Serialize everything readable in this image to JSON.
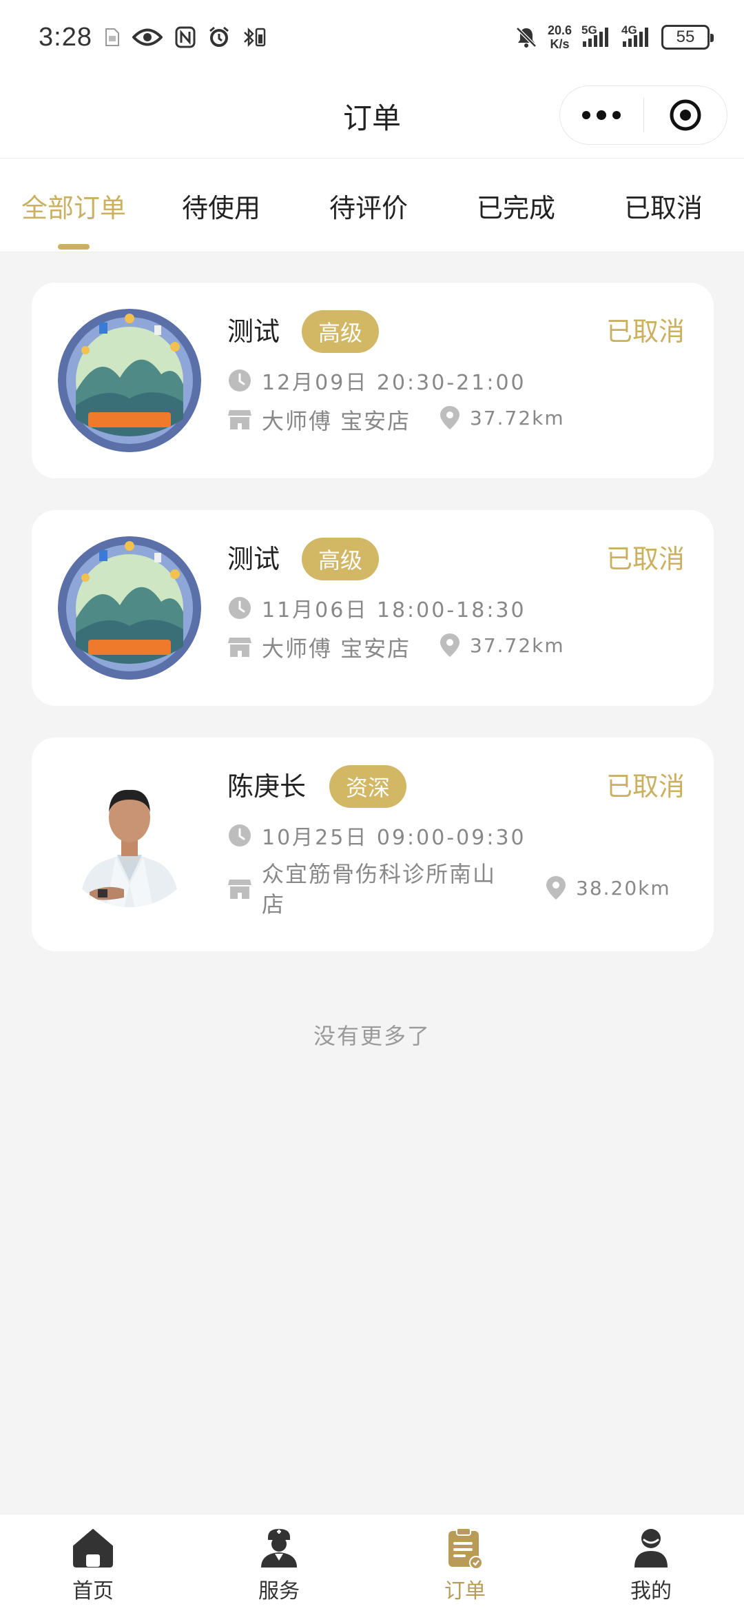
{
  "status_bar": {
    "time": "3:28",
    "net_speed_top": "20.6",
    "net_speed_bottom": "K/s",
    "net_5g": "5G",
    "net_4g": "4G",
    "battery": "55"
  },
  "header": {
    "title": "订单"
  },
  "tabs": [
    {
      "label": "全部订单",
      "active": true
    },
    {
      "label": "待使用",
      "active": false
    },
    {
      "label": "待评价",
      "active": false
    },
    {
      "label": "已完成",
      "active": false
    },
    {
      "label": "已取消",
      "active": false
    }
  ],
  "orders": [
    {
      "name": "测试",
      "level": "高级",
      "status": "已取消",
      "datetime": "12月09日 20:30-21:00",
      "store": "大师傅 宝安店",
      "distance": "37.72km"
    },
    {
      "name": "测试",
      "level": "高级",
      "status": "已取消",
      "datetime": "11月06日 18:00-18:30",
      "store": "大师傅 宝安店",
      "distance": "37.72km"
    },
    {
      "name": "陈庚长",
      "level": "资深",
      "status": "已取消",
      "datetime": "10月25日 09:00-09:30",
      "store_line1": "众宜筋骨伤科诊所南山",
      "store_line2": "店",
      "distance": "38.20km"
    }
  ],
  "footer_text": "没有更多了",
  "bottom_nav": [
    {
      "label": "首页",
      "icon": "home-icon",
      "active": false
    },
    {
      "label": "服务",
      "icon": "doctor-icon",
      "active": false
    },
    {
      "label": "订单",
      "icon": "order-clipboard-icon",
      "active": true
    },
    {
      "label": "我的",
      "icon": "user-icon",
      "active": false
    }
  ],
  "colors": {
    "accent": "#cbb061",
    "badge": "#d2b764",
    "background": "#f4f4f4"
  }
}
